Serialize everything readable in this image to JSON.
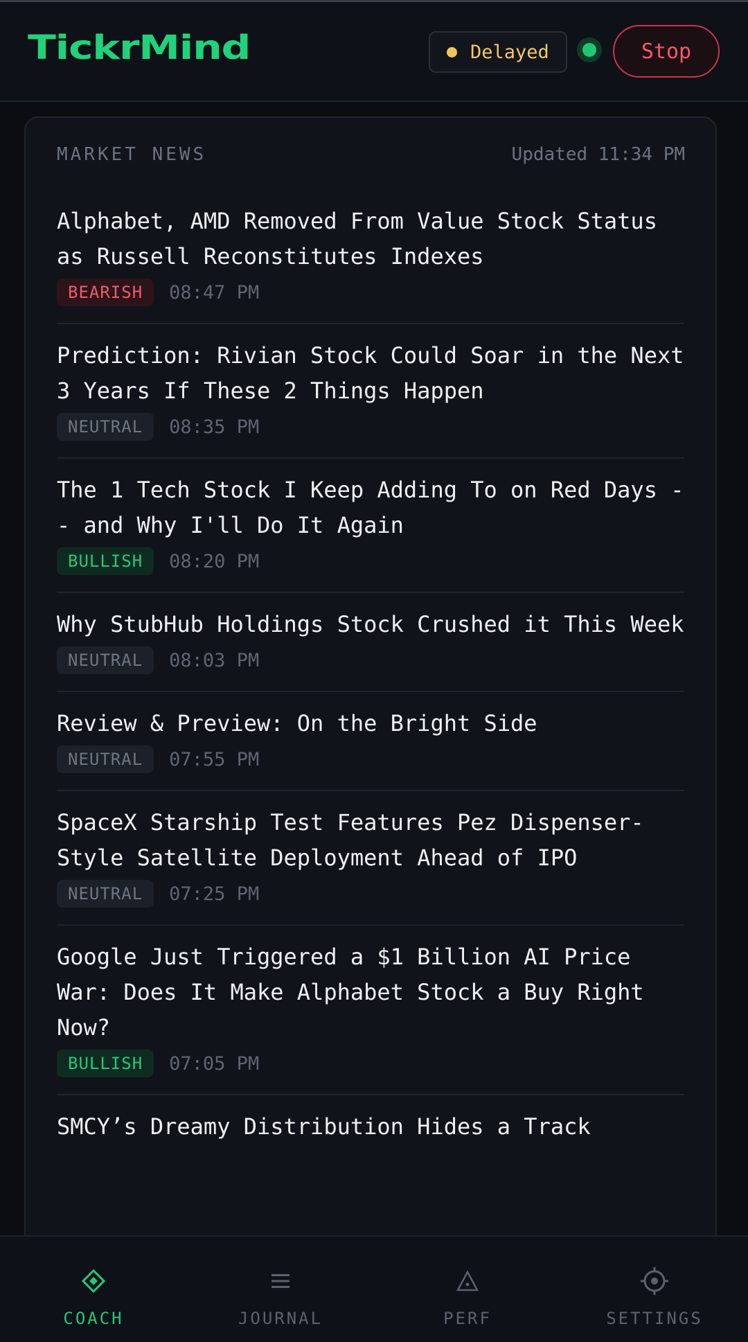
{
  "app": {
    "name": "TickrMind"
  },
  "header": {
    "status_label": "Delayed",
    "stop_label": "Stop"
  },
  "news": {
    "title": "MARKET NEWS",
    "updated": "Updated 11:34 PM",
    "items": [
      {
        "headline": "Alphabet, AMD Removed From Value Stock Status as Russell Reconstitutes Indexes",
        "sentiment": "BEARISH",
        "time": "08:47 PM"
      },
      {
        "headline": "Prediction: Rivian Stock Could Soar in the Next 3 Years If These 2 Things Happen",
        "sentiment": "NEUTRAL",
        "time": "08:35 PM"
      },
      {
        "headline": "The 1 Tech Stock I Keep Adding To on Red Days -- and Why I'll Do It Again",
        "sentiment": "BULLISH",
        "time": "08:20 PM"
      },
      {
        "headline": "Why StubHub Holdings Stock Crushed it This Week",
        "sentiment": "NEUTRAL",
        "time": "08:03 PM"
      },
      {
        "headline": "Review & Preview: On the Bright Side",
        "sentiment": "NEUTRAL",
        "time": "07:55 PM"
      },
      {
        "headline": "SpaceX Starship Test Features Pez Dispenser-Style Satellite Deployment Ahead of IPO",
        "sentiment": "NEUTRAL",
        "time": "07:25 PM"
      },
      {
        "headline": "Google Just Triggered a $1 Billion AI Price War: Does It Make Alphabet Stock a Buy Right Now?",
        "sentiment": "BULLISH",
        "time": "07:05 PM"
      },
      {
        "headline": "SMCY’s Dreamy Distribution Hides a Track",
        "sentiment": "",
        "time": ""
      }
    ]
  },
  "nav": {
    "items": [
      {
        "label": "COACH",
        "icon": "diamond-icon",
        "active": true
      },
      {
        "label": "JOURNAL",
        "icon": "list-icon",
        "active": false
      },
      {
        "label": "PERF",
        "icon": "triangle-icon",
        "active": false
      },
      {
        "label": "SETTINGS",
        "icon": "gear-icon",
        "active": false
      }
    ]
  },
  "colors": {
    "accent": "#22d27a",
    "bearish": "#ef5a6e",
    "bullish": "#23c97a",
    "warning": "#f2c55c"
  }
}
